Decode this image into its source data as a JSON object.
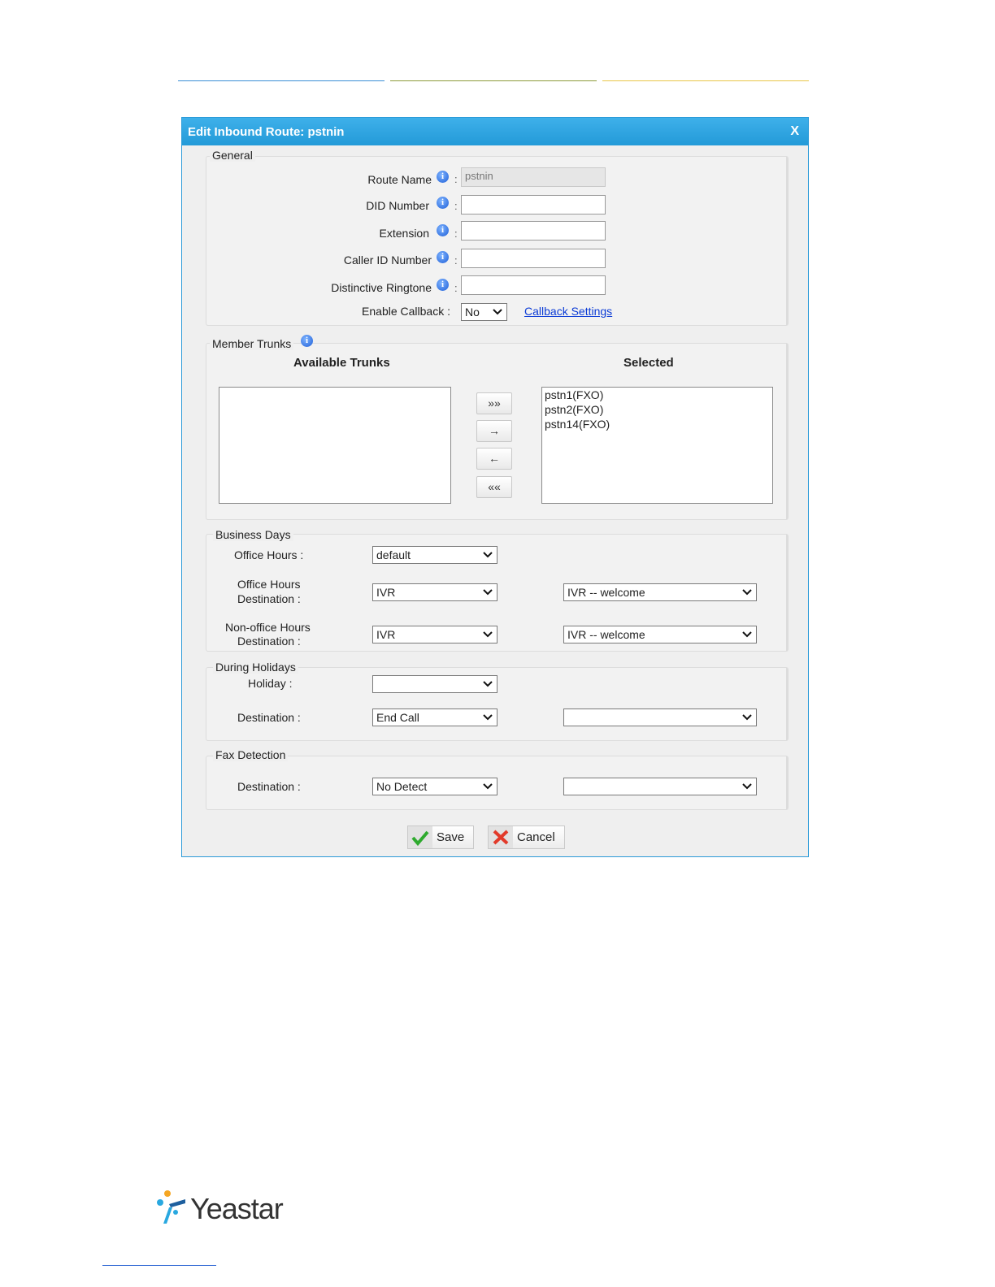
{
  "dialog": {
    "title": "Edit Inbound Route: pstnin",
    "close_label": "X"
  },
  "general": {
    "legend": "General",
    "route_name": {
      "label": "Route Name",
      "value": "pstnin"
    },
    "did_number": {
      "label": "DID Number",
      "value": ""
    },
    "extension": {
      "label": "Extension",
      "value": ""
    },
    "caller_id_number": {
      "label": "Caller ID Number",
      "value": ""
    },
    "distinctive_ringtone": {
      "label": "Distinctive Ringtone",
      "value": ""
    },
    "enable_callback": {
      "label": "Enable Callback :",
      "value": "No"
    },
    "callback_settings_link": "Callback Settings",
    "colon": ":"
  },
  "member_trunks": {
    "legend": "Member Trunks",
    "available_header": "Available Trunks",
    "selected_header": "Selected",
    "available": [],
    "selected": [
      "pstn1(FXO)",
      "pstn2(FXO)",
      "pstn14(FXO)"
    ],
    "buttons": {
      "add_all": "»»",
      "add": "→",
      "remove": "←",
      "remove_all": "««"
    }
  },
  "business_days": {
    "legend": "Business Days",
    "office_hours": {
      "label": "Office Hours :",
      "value": "default"
    },
    "office_hours_destination": {
      "label_line1": "Office Hours",
      "label_line2": "Destination :",
      "type": "IVR",
      "target": "IVR -- welcome"
    },
    "non_office_hours_destination": {
      "label_line1": "Non-office Hours",
      "label_line2": "Destination :",
      "type": "IVR",
      "target": "IVR -- welcome"
    }
  },
  "holidays": {
    "legend": "During Holidays",
    "holiday": {
      "label": "Holiday :",
      "value": ""
    },
    "destination": {
      "label": "Destination :",
      "type": "End Call",
      "target": ""
    }
  },
  "fax_detection": {
    "legend": "Fax Detection",
    "destination": {
      "label": "Destination :",
      "type": "No Detect",
      "target": ""
    }
  },
  "actions": {
    "save": "Save",
    "cancel": "Cancel"
  },
  "footer": {
    "brand": "Yeastar"
  },
  "colors": {
    "title_bar": "#239ad8",
    "link": "#0b3bd6",
    "rule_blue": "#3a8fd6",
    "rule_olive": "#8c9a3a",
    "rule_yellow": "#e8c548"
  }
}
